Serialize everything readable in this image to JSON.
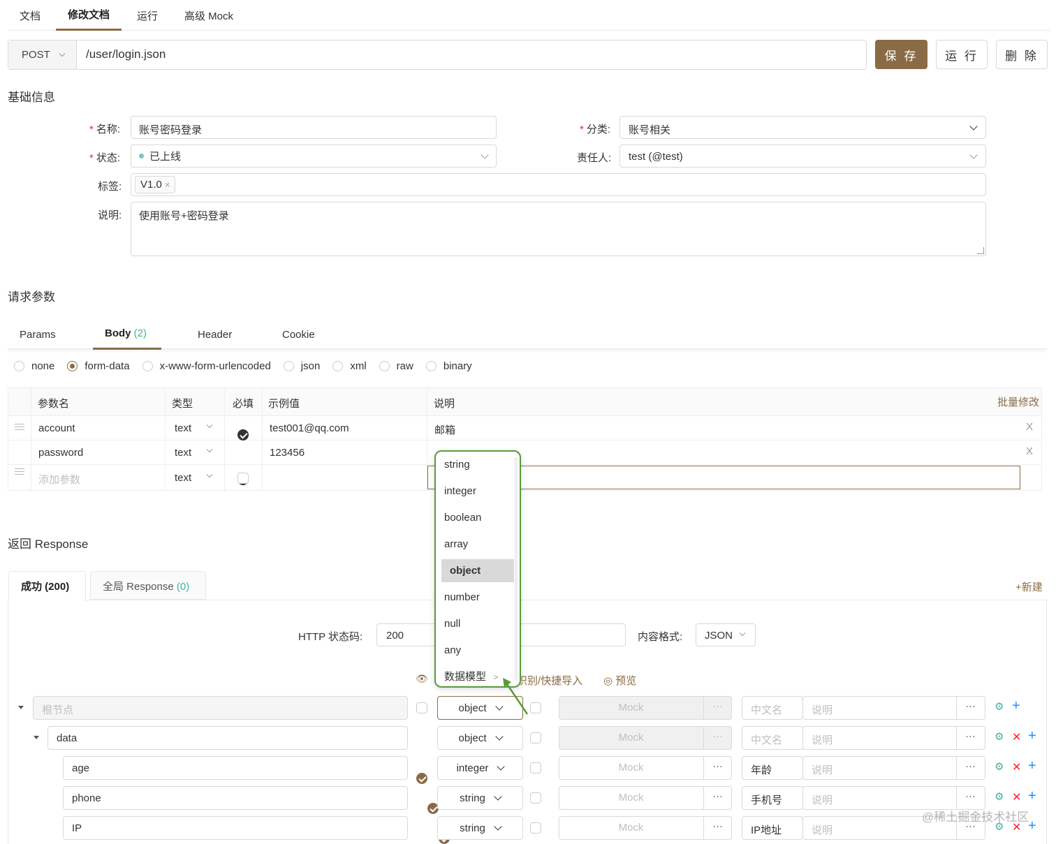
{
  "top_tabs": [
    "文档",
    "修改文档",
    "运行",
    "高级 Mock"
  ],
  "url_bar": {
    "method": "POST",
    "path": "/user/login.json",
    "save": "保 存",
    "run": "运 行",
    "delete": "删 除"
  },
  "basic": {
    "section_title": "基础信息",
    "name_label": "名称:",
    "name_value": "账号密码登录",
    "category_label": "分类:",
    "category_value": "账号相关",
    "status_label": "状态:",
    "status_value": "已上线",
    "owner_label": "责任人:",
    "owner_value": "test (@test)",
    "tags_label": "标签:",
    "tag": "V1.0",
    "desc_label": "说明:",
    "desc_value": "使用账号+密码登录"
  },
  "request": {
    "section_title": "请求参数",
    "tabs": {
      "params": "Params",
      "body": "Body",
      "body_count": "(2)",
      "header": "Header",
      "cookie": "Cookie"
    },
    "body_types": [
      "none",
      "form-data",
      "x-www-form-urlencoded",
      "json",
      "xml",
      "raw",
      "binary"
    ],
    "table": {
      "headers": [
        "参数名",
        "类型",
        "必填",
        "示例值",
        "说明"
      ],
      "batch_edit": "批量修改",
      "rows": [
        {
          "name": "account",
          "type": "text",
          "example": "test001@qq.com",
          "desc": "邮箱"
        },
        {
          "name": "password",
          "type": "text",
          "example": "123456",
          "desc": ""
        }
      ],
      "add_placeholder": "添加参数",
      "add_type": "text"
    }
  },
  "dropdown": {
    "items": [
      "string",
      "integer",
      "boolean",
      "array",
      "object",
      "number",
      "null",
      "any",
      "数据模型"
    ],
    "selected": "object"
  },
  "response": {
    "section_title": "返回 Response",
    "tab_success": "成功 (200)",
    "tab_global": "全局 Response",
    "tab_global_count": "(0)",
    "new": "+新建",
    "http_status_label": "HTTP 状态码:",
    "http_status_value": "200",
    "format_label": "内容格式:",
    "format_value": "JSON",
    "tools_import": "识别/快捷导入",
    "tools_preview": "预览",
    "tree": [
      {
        "name": "根节点",
        "placeholder": true,
        "checked": false,
        "type": "object",
        "mock": "Mock",
        "cn": "中文名",
        "cn_placeholder": true,
        "desc": "说明"
      },
      {
        "name": "data",
        "placeholder": false,
        "checked": true,
        "type": "object",
        "mock": "Mock",
        "cn": "中文名",
        "cn_placeholder": true,
        "desc": "说明"
      },
      {
        "name": "age",
        "placeholder": false,
        "checked": true,
        "type": "integer",
        "mock": "Mock",
        "cn": "年龄",
        "cn_placeholder": false,
        "desc": "说明"
      },
      {
        "name": "phone",
        "placeholder": false,
        "checked": true,
        "type": "string",
        "mock": "Mock",
        "cn": "手机号",
        "cn_placeholder": false,
        "desc": "说明"
      },
      {
        "name": "IP",
        "placeholder": false,
        "checked": true,
        "type": "string",
        "mock": "Mock",
        "cn": "IP地址",
        "cn_placeholder": false,
        "desc": "说明"
      }
    ]
  },
  "watermark": "@稀土掘金技术社区",
  "colors": {
    "accent": "#8b6b45",
    "highlight_green": "#5a9a3a"
  }
}
